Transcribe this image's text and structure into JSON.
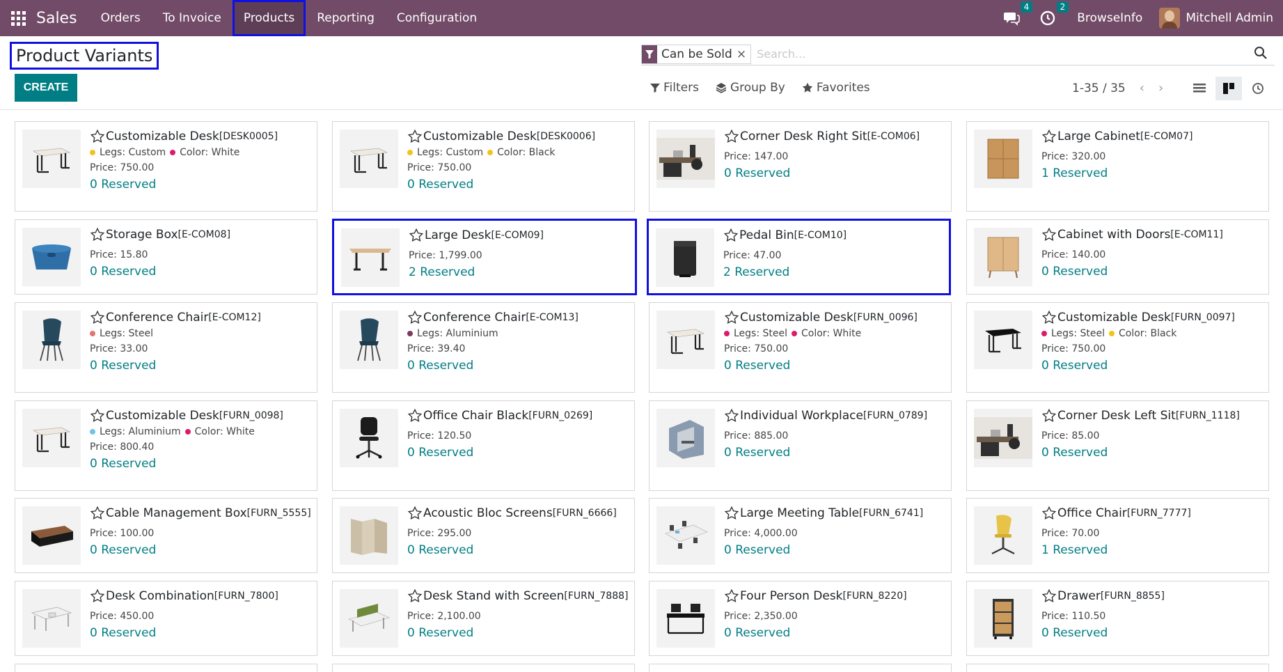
{
  "navbar": {
    "app_name": "Sales",
    "menu": [
      "Orders",
      "To Invoice",
      "Products",
      "Reporting",
      "Configuration"
    ],
    "active_menu": "Products",
    "messages_count": "4",
    "activities_count": "2",
    "company": "BrowseInfo",
    "user": "Mitchell Admin",
    "accent_color": "#714B67"
  },
  "control": {
    "title": "Product Variants",
    "create_label": "CREATE",
    "facet_label": "Can be Sold",
    "facet_remove": "×",
    "search_placeholder": "Search...",
    "filters_label": "Filters",
    "groupby_label": "Group By",
    "favorites_label": "Favorites",
    "pager": "1-35 / 35",
    "pager_prev": "‹",
    "pager_next": "›"
  },
  "colors": {
    "primary": "#017e84",
    "highlight": "#1010e0"
  },
  "products": [
    {
      "name": "Customizable Desk",
      "code": "[DESK0005]",
      "attrs": [
        {
          "label": "Legs: Custom",
          "color": "#f0c419"
        },
        {
          "label": "Color: White",
          "color": "#dc1b6b"
        }
      ],
      "price": "Price: 750.00",
      "reserved": "0 Reserved",
      "img": "desk-white"
    },
    {
      "name": "Customizable Desk",
      "code": "[DESK0006]",
      "attrs": [
        {
          "label": "Legs: Custom",
          "color": "#f0c419"
        },
        {
          "label": "Color: Black",
          "color": "#f0c419"
        }
      ],
      "price": "Price: 750.00",
      "reserved": "0 Reserved",
      "img": "desk-white"
    },
    {
      "name": "Corner Desk Right Sit",
      "code": "[E-COM06]",
      "attrs": [],
      "price": "Price: 147.00",
      "reserved": "0 Reserved",
      "img": "office-scene"
    },
    {
      "name": "Large Cabinet",
      "code": "[E-COM07]",
      "attrs": [],
      "price": "Price: 320.00",
      "reserved": "1 Reserved",
      "img": "cabinet"
    },
    {
      "name": "Storage Box",
      "code": "[E-COM08]",
      "attrs": [],
      "price": "Price: 15.80",
      "reserved": "0 Reserved",
      "img": "storage-box"
    },
    {
      "name": "Large Desk",
      "code": "[E-COM09]",
      "attrs": [],
      "price": "Price: 1,799.00",
      "reserved": "2 Reserved",
      "img": "large-desk",
      "highlight": true
    },
    {
      "name": "Pedal Bin",
      "code": "[E-COM10]",
      "attrs": [],
      "price": "Price: 47.00",
      "reserved": "2 Reserved",
      "img": "bin",
      "highlight": true
    },
    {
      "name": "Cabinet with Doors",
      "code": "[E-COM11]",
      "attrs": [],
      "price": "Price: 140.00",
      "reserved": "0 Reserved",
      "img": "cabinet-doors"
    },
    {
      "name": "Conference Chair",
      "code": "[E-COM12]",
      "attrs": [
        {
          "label": "Legs: Steel",
          "color": "#e57373"
        }
      ],
      "price": "Price: 33.00",
      "reserved": "0 Reserved",
      "img": "chair-blue"
    },
    {
      "name": "Conference Chair",
      "code": "[E-COM13]",
      "attrs": [
        {
          "label": "Legs: Aluminium",
          "color": "#7b3a5e"
        }
      ],
      "price": "Price: 39.40",
      "reserved": "0 Reserved",
      "img": "chair-blue"
    },
    {
      "name": "Customizable Desk",
      "code": "[FURN_0096]",
      "attrs": [
        {
          "label": "Legs: Steel",
          "color": "#dc1b6b"
        },
        {
          "label": "Color: White",
          "color": "#dc1b6b"
        }
      ],
      "price": "Price: 750.00",
      "reserved": "0 Reserved",
      "img": "desk-white"
    },
    {
      "name": "Customizable Desk",
      "code": "[FURN_0097]",
      "attrs": [
        {
          "label": "Legs: Steel",
          "color": "#dc1b6b"
        },
        {
          "label": "Color: Black",
          "color": "#f0c419"
        }
      ],
      "price": "Price: 750.00",
      "reserved": "0 Reserved",
      "img": "desk-black"
    },
    {
      "name": "Customizable Desk",
      "code": "[FURN_0098]",
      "attrs": [
        {
          "label": "Legs: Aluminium",
          "color": "#6ec6e6"
        },
        {
          "label": "Color: White",
          "color": "#dc1b6b"
        }
      ],
      "price": "Price: 800.40",
      "reserved": "0 Reserved",
      "img": "desk-white"
    },
    {
      "name": "Office Chair Black",
      "code": "[FURN_0269]",
      "attrs": [],
      "price": "Price: 120.50",
      "reserved": "0 Reserved",
      "img": "office-chair"
    },
    {
      "name": "Individual Workplace",
      "code": "[FURN_0789]",
      "attrs": [],
      "price": "Price: 885.00",
      "reserved": "0 Reserved",
      "img": "workplace"
    },
    {
      "name": "Corner Desk Left Sit",
      "code": "[FURN_1118]",
      "attrs": [],
      "price": "Price: 85.00",
      "reserved": "0 Reserved",
      "img": "office-scene"
    },
    {
      "name": "Cable Management Box",
      "code": "[FURN_5555]",
      "attrs": [],
      "price": "Price: 100.00",
      "reserved": "0 Reserved",
      "img": "cable-box"
    },
    {
      "name": "Acoustic Bloc Screens",
      "code": "[FURN_6666]",
      "attrs": [],
      "price": "Price: 295.00",
      "reserved": "0 Reserved",
      "img": "screens"
    },
    {
      "name": "Large Meeting Table",
      "code": "[FURN_6741]",
      "attrs": [],
      "price": "Price: 4,000.00",
      "reserved": "0 Reserved",
      "img": "meeting-table"
    },
    {
      "name": "Office Chair",
      "code": "[FURN_7777]",
      "attrs": [],
      "price": "Price: 70.00",
      "reserved": "1 Reserved",
      "img": "chair-yellow"
    },
    {
      "name": "Desk Combination",
      "code": "[FURN_7800]",
      "attrs": [],
      "price": "Price: 450.00",
      "reserved": "0 Reserved",
      "img": "desk-combo"
    },
    {
      "name": "Desk Stand with Screen",
      "code": "[FURN_7888]",
      "attrs": [],
      "price": "Price: 2,100.00",
      "reserved": "0 Reserved",
      "img": "desk-screen"
    },
    {
      "name": "Four Person Desk",
      "code": "[FURN_8220]",
      "attrs": [],
      "price": "Price: 2,350.00",
      "reserved": "0 Reserved",
      "img": "four-desk"
    },
    {
      "name": "Drawer",
      "code": "[FURN_8855]",
      "attrs": [],
      "price": "Price: 110.50",
      "reserved": "0 Reserved",
      "img": "drawer"
    }
  ]
}
